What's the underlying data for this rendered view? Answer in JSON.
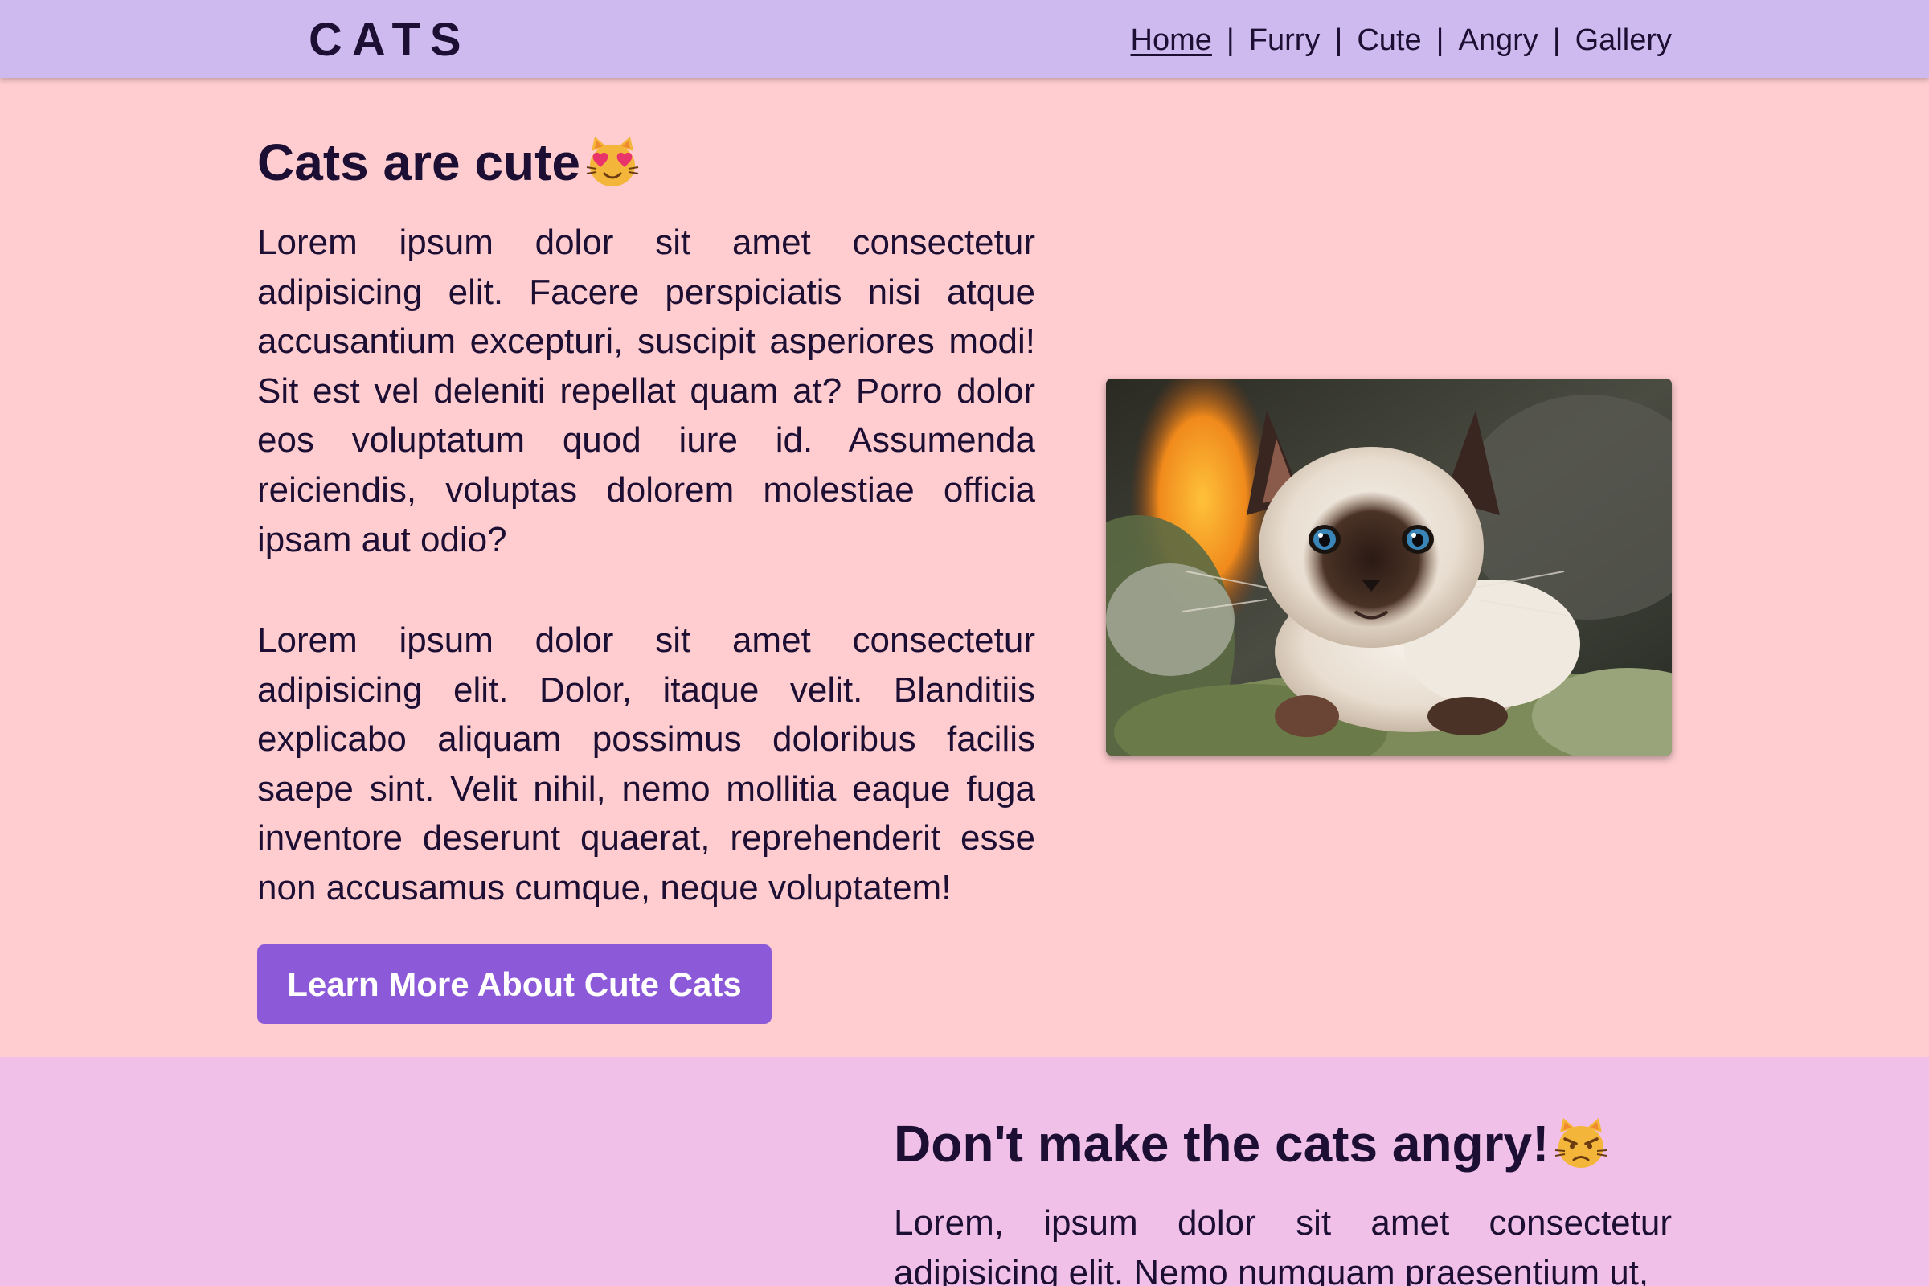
{
  "header": {
    "logo": "CATS",
    "nav": [
      {
        "label": "Home",
        "active": true
      },
      {
        "label": "Furry"
      },
      {
        "label": "Cute"
      },
      {
        "label": "Angry"
      },
      {
        "label": "Gallery"
      }
    ],
    "separator": "|"
  },
  "cute_section": {
    "title": "Cats are cute",
    "title_icon": "heart-eyes-cat-icon",
    "paragraphs": [
      "Lorem ipsum dolor sit amet consectetur adipisicing elit. Facere perspiciatis nisi atque accusantium excepturi, suscipit asperiores modi! Sit est vel deleniti repellat quam at? Porro dolor eos voluptatum quod iure id. Assumenda reiciendis, voluptas dolorem molestiae officia ipsam aut odio?",
      "Lorem ipsum dolor sit amet consectetur adipisicing elit. Dolor, itaque velit. Blanditiis explicabo aliquam possimus doloribus facilis saepe sint. Velit nihil, nemo mollitia eaque fuga inventore deserunt quaerat, reprehenderit esse non accusamus cumque, neque voluptatem!"
    ],
    "button_label": "Learn More About Cute Cats",
    "image": "siamese-kitten-photo"
  },
  "angry_section": {
    "title": "Don't make the cats angry!",
    "title_icon": "pouting-cat-icon",
    "paragraph": "Lorem, ipsum dolor sit amet consectetur adipisicing elit. Nemo numquam praesentium ut,"
  },
  "colors": {
    "header_bg": "#cfbaf0",
    "cute_bg": "#ffcdd0",
    "angry_bg": "#f0c0e8",
    "button_bg": "#8c5ad9",
    "text": "#1c0f33"
  }
}
